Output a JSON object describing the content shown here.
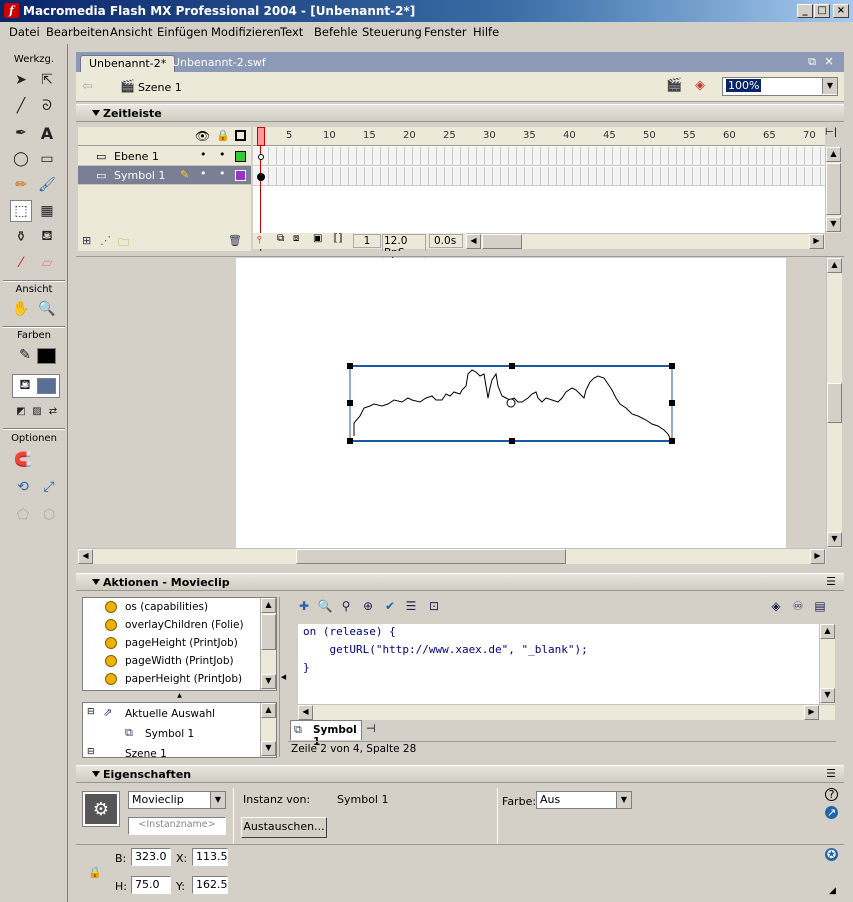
{
  "window": {
    "title": "Macromedia Flash MX Professional 2004 - [Unbenannt-2*]"
  },
  "menu": [
    "Datei",
    "Bearbeiten",
    "Ansicht",
    "Einfügen",
    "Modifizieren",
    "Text",
    "Befehle",
    "Steuerung",
    "Fenster",
    "Hilfe"
  ],
  "tools": {
    "header_tools": "Werkzg.",
    "header_view": "Ansicht",
    "header_colors": "Farben",
    "header_options": "Optionen"
  },
  "tabs": {
    "active": "Unbenannt-2*",
    "inactive": "Unbenannt-2.swf"
  },
  "scene": {
    "label": "Szene 1",
    "zoom": "100%"
  },
  "timeline": {
    "title": "Zeitleiste",
    "ruler": [
      "1",
      "5",
      "10",
      "15",
      "20",
      "25",
      "30",
      "35",
      "40",
      "45",
      "50",
      "55",
      "60",
      "65",
      "70"
    ],
    "layers": [
      {
        "name": "Ebene 1",
        "color": "#33cc33"
      },
      {
        "name": "Symbol 1",
        "color": "#9933cc"
      }
    ],
    "frame": "1",
    "fps": "12.0 BpS",
    "time": "0.0s"
  },
  "actions": {
    "title": "Aktionen - Movieclip",
    "list": [
      "os (capabilities)",
      "overlayChildren (Folie)",
      "pageHeight (PrintJob)",
      "pageWidth (PrintJob)",
      "paperHeight (PrintJob)"
    ],
    "tree": [
      "Aktuelle Auswahl",
      "Symbol 1",
      "Szene 1"
    ],
    "code": [
      "on (release) {",
      "    getURL(\"http://www.xaex.de\", \"_blank\");",
      "}"
    ],
    "script_tab": "Symbol 1",
    "status": "Zeile 2 von 4, Spalte 28"
  },
  "properties": {
    "title": "Eigenschaften",
    "type": "Movieclip",
    "instance_placeholder": "<Instanzname>",
    "instance_of_label": "Instanz von:",
    "instance_of": "Symbol 1",
    "swap_button": "Austauschen...",
    "color_label": "Farbe:",
    "color_value": "Aus",
    "w_label": "B:",
    "w": "323.0",
    "h_label": "H:",
    "h": "75.0",
    "x_label": "X:",
    "x": "113.5",
    "y_label": "Y:",
    "y": "162.5"
  }
}
